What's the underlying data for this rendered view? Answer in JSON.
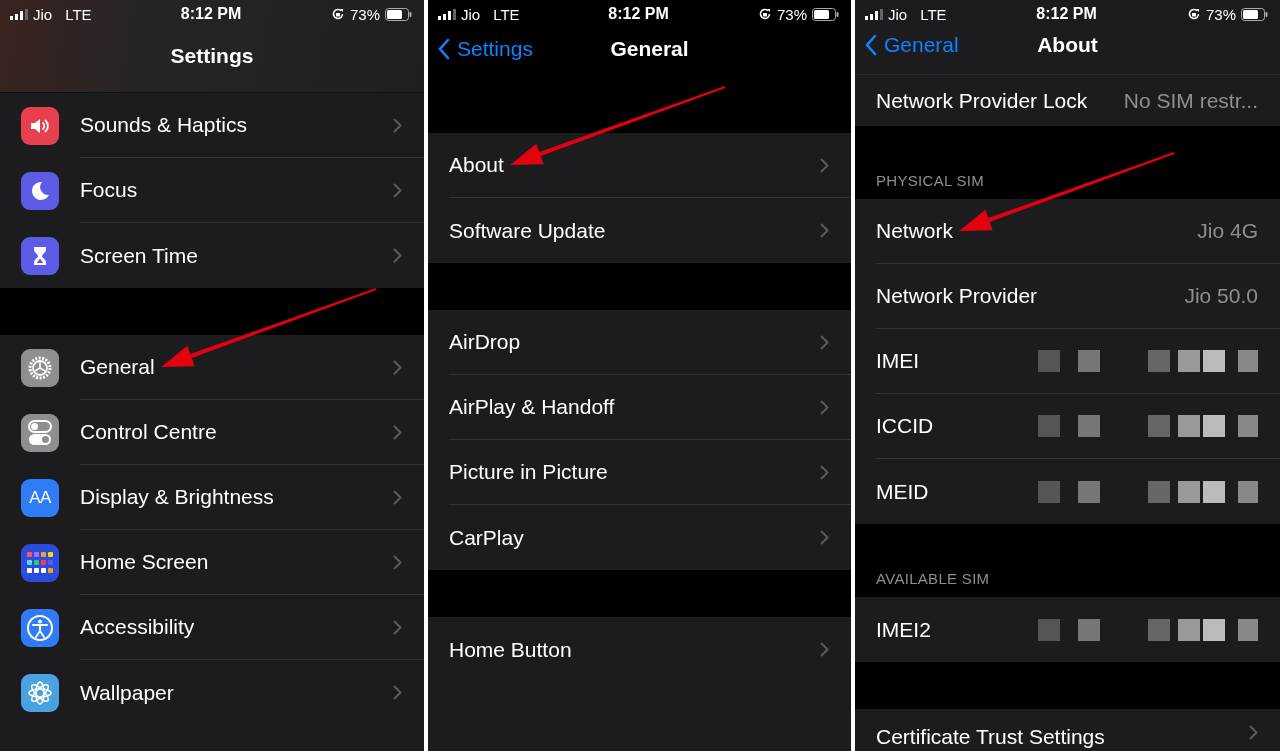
{
  "panels": [
    {
      "status_bar": {
        "carrier": "Jio",
        "network": "LTE",
        "time": "8:12 PM",
        "battery": "73%"
      },
      "nav": {
        "title": "Settings"
      },
      "groups": [
        {
          "rows": [
            {
              "label": "Sounds & Haptics",
              "kind": "sound",
              "chevron": true,
              "pointed": false
            },
            {
              "label": "Focus",
              "kind": "focus",
              "chevron": true,
              "pointed": false
            },
            {
              "label": "Screen Time",
              "kind": "screen-time",
              "chevron": true,
              "pointed": false
            }
          ]
        },
        {
          "rows": [
            {
              "label": "General",
              "kind": "general",
              "chevron": true,
              "pointed": true
            },
            {
              "label": "Control Centre",
              "kind": "control",
              "chevron": true,
              "pointed": false
            },
            {
              "label": "Display & Brightness",
              "kind": "display",
              "icon_text": "AA",
              "chevron": true,
              "pointed": false
            },
            {
              "label": "Home Screen",
              "kind": "home",
              "chevron": true,
              "pointed": false
            },
            {
              "label": "Accessibility",
              "kind": "accessibility",
              "chevron": true,
              "pointed": false
            },
            {
              "label": "Wallpaper",
              "kind": "wallpaper",
              "chevron": true,
              "pointed": false
            }
          ]
        }
      ]
    },
    {
      "status_bar": {
        "carrier": "Jio",
        "network": "LTE",
        "time": "8:12 PM",
        "battery": "73%"
      },
      "nav": {
        "back": "Settings",
        "title": "General"
      },
      "groups": [
        {
          "rows": [
            {
              "label": "About",
              "chevron": true,
              "pointed": true
            },
            {
              "label": "Software Update",
              "chevron": true,
              "pointed": false
            }
          ]
        },
        {
          "rows": [
            {
              "label": "AirDrop",
              "chevron": true,
              "pointed": false
            },
            {
              "label": "AirPlay & Handoff",
              "chevron": true,
              "pointed": false
            },
            {
              "label": "Picture in Picture",
              "chevron": true,
              "pointed": false
            },
            {
              "label": "CarPlay",
              "chevron": true,
              "pointed": false
            }
          ]
        },
        {
          "rows": [
            {
              "label": "Home Button",
              "chevron": true,
              "pointed": false
            }
          ]
        }
      ]
    },
    {
      "status_bar": {
        "carrier": "Jio",
        "network": "LTE",
        "time": "8:12 PM",
        "battery": "73%"
      },
      "nav": {
        "back": "General",
        "title": "About"
      },
      "groups": [
        {
          "rows": [
            {
              "label": "Network Provider Lock",
              "value": "No SIM restr...",
              "chevron": false,
              "pointed": false
            }
          ]
        },
        {
          "header": "PHYSICAL SIM",
          "rows": [
            {
              "label": "Network",
              "value": "Jio 4G",
              "chevron": false,
              "pointed": true
            },
            {
              "label": "Network Provider",
              "value": "Jio 50.0",
              "chevron": false,
              "pointed": false
            },
            {
              "label": "IMEI",
              "redacted": true,
              "chevron": false,
              "pointed": false
            },
            {
              "label": "ICCID",
              "redacted": true,
              "chevron": false,
              "pointed": false
            },
            {
              "label": "MEID",
              "redacted": true,
              "chevron": false,
              "pointed": false
            }
          ]
        },
        {
          "header": "AVAILABLE SIM",
          "rows": [
            {
              "label": "IMEI2",
              "redacted": true,
              "chevron": false,
              "pointed": false
            }
          ]
        },
        {
          "rows": [
            {
              "label": "Certificate Trust Settings",
              "chevron": true,
              "pointed": false
            }
          ]
        }
      ]
    }
  ]
}
